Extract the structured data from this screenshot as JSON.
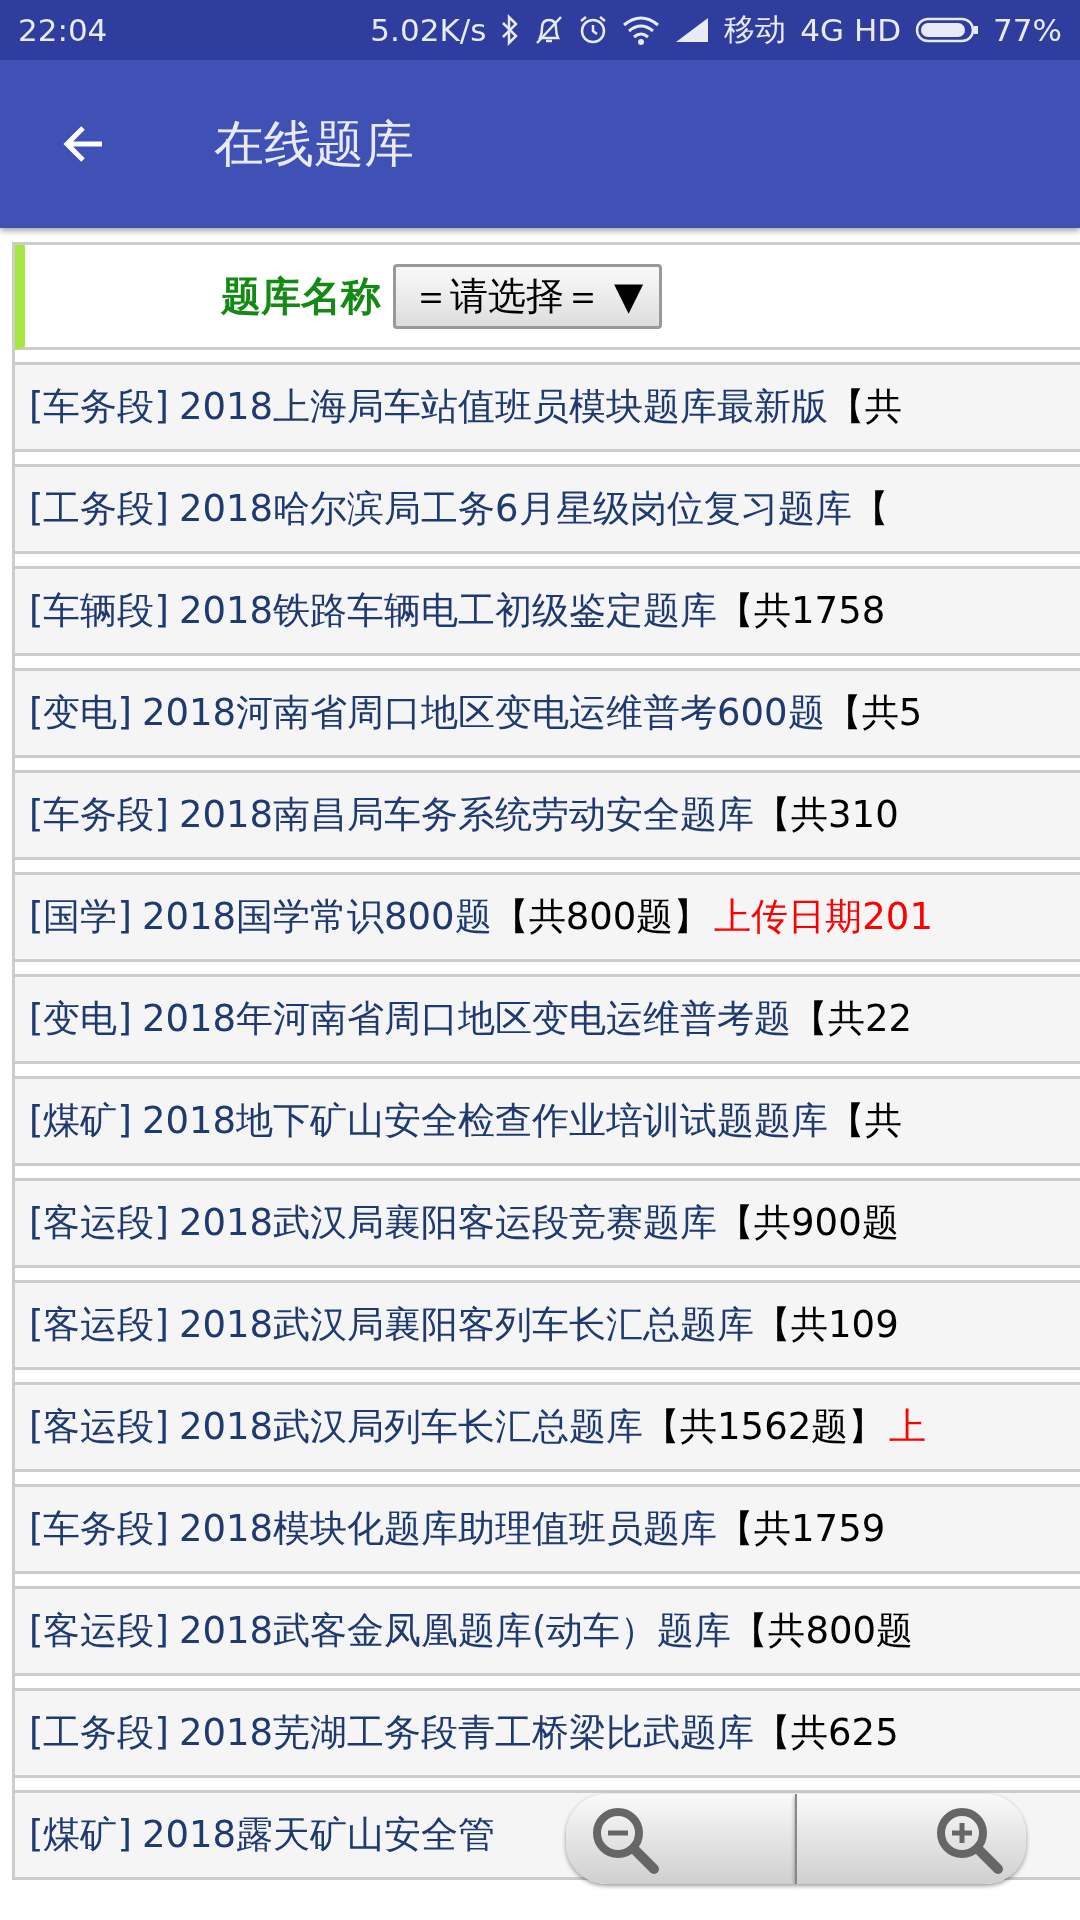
{
  "status_bar": {
    "time": "22:04",
    "speed": "5.02K/s",
    "carrier": "移动",
    "network": "4G HD",
    "battery": "77%"
  },
  "app_bar": {
    "title": "在线题库"
  },
  "filter": {
    "label": "题库名称",
    "select_value": "＝请选择＝ ▼"
  },
  "rows": [
    {
      "category": "[车务段]",
      "title": "2018上海局车站值班员模块题库最新版",
      "count": "【共"
    },
    {
      "category": "[工务段]",
      "title": "2018哈尔滨局工务6月星级岗位复习题库",
      "count": "【"
    },
    {
      "category": "[车辆段]",
      "title": "2018铁路车辆电工初级鉴定题库",
      "count": "【共1758"
    },
    {
      "category": "[变电]",
      "title": "2018河南省周口地区变电运维普考600题",
      "count": "【共5"
    },
    {
      "category": "[车务段]",
      "title": "2018南昌局车务系统劳动安全题库",
      "count": "【共310"
    },
    {
      "category": "[国学]",
      "title": "2018国学常识800题",
      "count": "【共800题】",
      "date": "上传日期201"
    },
    {
      "category": "[变电]",
      "title": "2018年河南省周口地区变电运维普考题",
      "count": "【共22"
    },
    {
      "category": "[煤矿]",
      "title": "2018地下矿山安全检查作业培训试题题库",
      "count": "【共"
    },
    {
      "category": "[客运段]",
      "title": "2018武汉局襄阳客运段竞赛题库",
      "count": "【共900题"
    },
    {
      "category": "[客运段]",
      "title": "2018武汉局襄阳客列车长汇总题库",
      "count": "【共109"
    },
    {
      "category": "[客运段]",
      "title": "2018武汉局列车长汇总题库",
      "count": "【共1562题】",
      "date": "上"
    },
    {
      "category": "[车务段]",
      "title": "2018模块化题库助理值班员题库",
      "count": "【共1759"
    },
    {
      "category": "[客运段]",
      "title": "2018武客金凤凰题库(动车）题库",
      "count": "【共800题"
    },
    {
      "category": "[工务段]",
      "title": "2018芜湖工务段青工桥梁比武题库",
      "count": "【共625"
    },
    {
      "category": "[煤矿]",
      "title": "2018露天矿山安全管"
    }
  ]
}
